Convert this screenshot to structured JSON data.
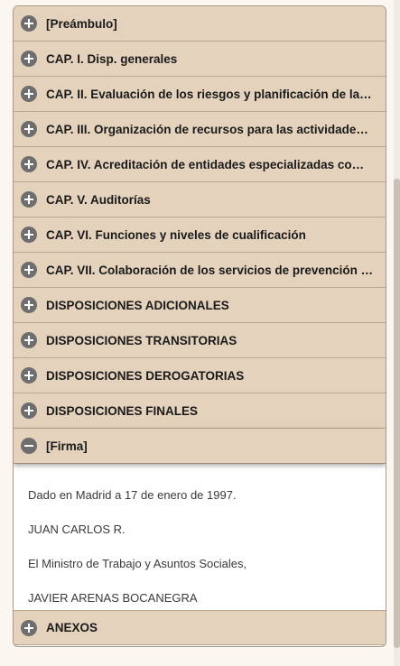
{
  "sections": [
    {
      "label": "[Preámbulo]"
    },
    {
      "label": "CAP. I. Disp. generales"
    },
    {
      "label": "CAP. II. Evaluación de los riesgos y planificación de la actividad preventiva"
    },
    {
      "label": "CAP. III. Organización de recursos para las actividades preventivas"
    },
    {
      "label": "CAP. IV. Acreditación de entidades especializadas como servicios de prevención"
    },
    {
      "label": "CAP. V. Auditorías"
    },
    {
      "label": "CAP. VI. Funciones y niveles de cualificación"
    },
    {
      "label": "CAP. VII. Colaboración de los servicios de prevención con el Sistema Nacional de Salud"
    },
    {
      "label": "DISPOSICIONES ADICIONALES"
    },
    {
      "label": "DISPOSICIONES TRANSITORIAS"
    },
    {
      "label": "DISPOSICIONES DEROGATORIAS"
    },
    {
      "label": "DISPOSICIONES FINALES"
    }
  ],
  "open_section": {
    "label": "[Firma]",
    "lines": [
      "Dado en Madrid a 17 de enero de 1997.",
      "JUAN CARLOS R.",
      "El Ministro de Trabajo y Asuntos Sociales,",
      "JAVIER ARENAS BOCANEGRA"
    ]
  },
  "last_section": {
    "label": "ANEXOS"
  }
}
